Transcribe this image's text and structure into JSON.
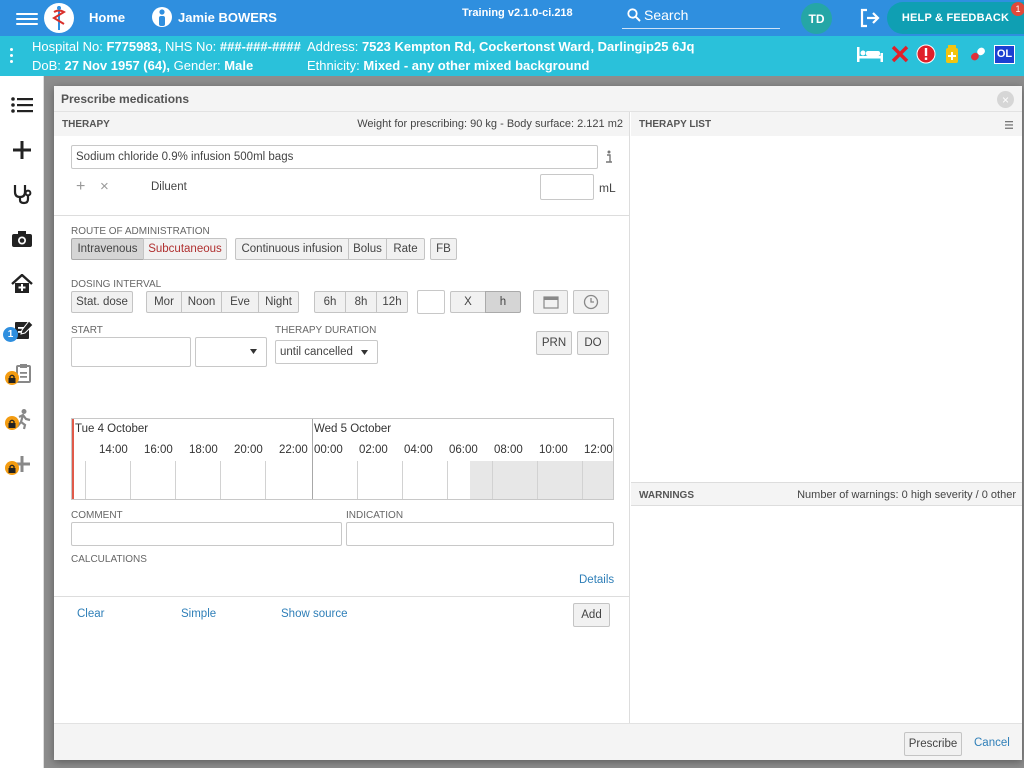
{
  "topnav": {
    "home_label": "Home",
    "patient_name": "Jamie BOWERS",
    "version": "Training v2.1.0-ci.218",
    "search_placeholder": "Search",
    "user_initials": "TD",
    "help_label": "HELP & FEEDBACK",
    "help_badge": "1"
  },
  "banner": {
    "hospital_label": "Hospital No:",
    "hospital_no": "F775983,",
    "nhs_label": "NHS No:",
    "nhs_no": "###-###-####",
    "dob_label": "DoB:",
    "dob": "27 Nov 1957 (64),",
    "gender_label": "Gender:",
    "gender": "Male",
    "address_label": "Address:",
    "address": "7523 Kempton Rd, Cockertonst Ward, Darlingip25 6Jq",
    "ethnicity_label": "Ethnicity:",
    "ethnicity": "Mixed - any other mixed background",
    "ol_badge": "OL"
  },
  "sidebar": {
    "notification_count": "1"
  },
  "dialog": {
    "title": "Prescribe medications",
    "therapy_header": "THERAPY",
    "weight_info": "Weight for prescribing: 90 kg - Body surface: 2.121 m2",
    "medication_value": "Sodium chloride 0.9% infusion 500ml bags",
    "diluent_label": "Diluent",
    "volume_unit": "mL",
    "route_label": "ROUTE OF ADMINISTRATION",
    "routes": [
      "Intravenous",
      "Subcutaneous"
    ],
    "infusion_types": [
      "Continuous infusion",
      "Bolus",
      "Rate"
    ],
    "fb_label": "FB",
    "dosing_label": "DOSING INTERVAL",
    "stat_dose": "Stat. dose",
    "times_of_day": [
      "Mor",
      "Noon",
      "Eve",
      "Night"
    ],
    "hour_intervals": [
      "6h",
      "8h",
      "12h"
    ],
    "x_label": "X",
    "h_label": "h",
    "start_label": "START",
    "duration_label": "THERAPY DURATION",
    "duration_value": "until cancelled",
    "prn_label": "PRN",
    "do_label": "DO",
    "timeline": {
      "day1": "Tue 4 October",
      "day2": "Wed 5 October",
      "hours1": [
        "14:00",
        "16:00",
        "18:00",
        "20:00",
        "22:00"
      ],
      "hours2": [
        "00:00",
        "02:00",
        "04:00",
        "06:00",
        "08:00",
        "10:00",
        "12:00"
      ]
    },
    "comment_label": "COMMENT",
    "indication_label": "INDICATION",
    "calculations_label": "CALCULATIONS",
    "details_link": "Details",
    "clear_link": "Clear",
    "simple_link": "Simple",
    "show_source_link": "Show source",
    "add_button": "Add",
    "therapy_list_header": "THERAPY LIST",
    "warnings_header": "WARNINGS",
    "warnings_info": "Number of warnings: 0 high severity / 0 other",
    "prescribe_button": "Prescribe",
    "cancel_link": "Cancel"
  },
  "colors": {
    "nav": "#2f8fdf",
    "banner": "#2ac1da",
    "help": "#0f9fb3",
    "lock": "#f39c12",
    "link": "#2f7fb8"
  }
}
